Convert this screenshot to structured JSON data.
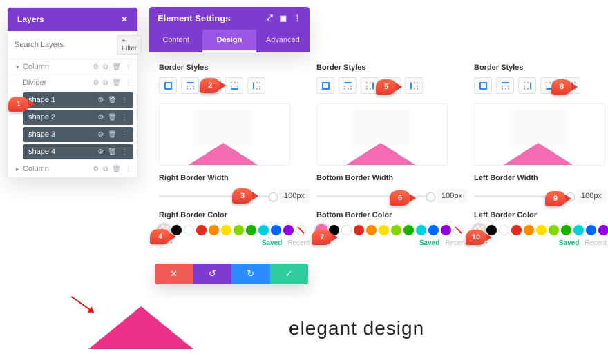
{
  "layers": {
    "title": "Layers",
    "close": "✕",
    "search_placeholder": "Search Layers",
    "filter": "+ Filter",
    "rows": [
      {
        "label": "Column",
        "type": "outer"
      },
      {
        "label": "Divider",
        "type": "divider"
      },
      {
        "label": "shape 1",
        "type": "shape"
      },
      {
        "label": "shape 2",
        "type": "shape"
      },
      {
        "label": "shape 3",
        "type": "shape"
      },
      {
        "label": "shape 4",
        "type": "shape"
      },
      {
        "label": "Column",
        "type": "outer"
      }
    ],
    "icons": {
      "gear": "⚙",
      "copy": "⧉",
      "trash": "🗑",
      "more": "⋮"
    }
  },
  "settings": {
    "title": "Element Settings",
    "title_icons": {
      "expand": "⤢",
      "responsive": "▣",
      "more": "⋮"
    },
    "tabs": {
      "content": "Content",
      "design": "Design",
      "advanced": "Advanced"
    }
  },
  "columns": [
    {
      "border_label": "Border Styles",
      "width_label": "Right Border Width",
      "width_value": "100px",
      "color_label": "Right Border Color",
      "active_style": "right",
      "selected_color": "transparent"
    },
    {
      "border_label": "Border Styles",
      "width_label": "Bottom Border Width",
      "width_value": "100px",
      "color_label": "Bottom Border Color",
      "active_style": "bottom",
      "selected_color": "pink"
    },
    {
      "border_label": "Border Styles",
      "width_label": "Left Border Width",
      "width_value": "100px",
      "color_label": "Left Border Color",
      "active_style": "left",
      "selected_color": "transparent"
    }
  ],
  "saved_recent": {
    "saved": "Saved",
    "recent": "Recent",
    "dots": "• • •"
  },
  "actions": {
    "cancel": "✕",
    "undo": "↺",
    "redo": "↻",
    "save": "✓"
  },
  "callouts": [
    "1",
    "2",
    "3",
    "4",
    "5",
    "6",
    "7",
    "8",
    "9",
    "10"
  ],
  "elegant": "elegant design"
}
